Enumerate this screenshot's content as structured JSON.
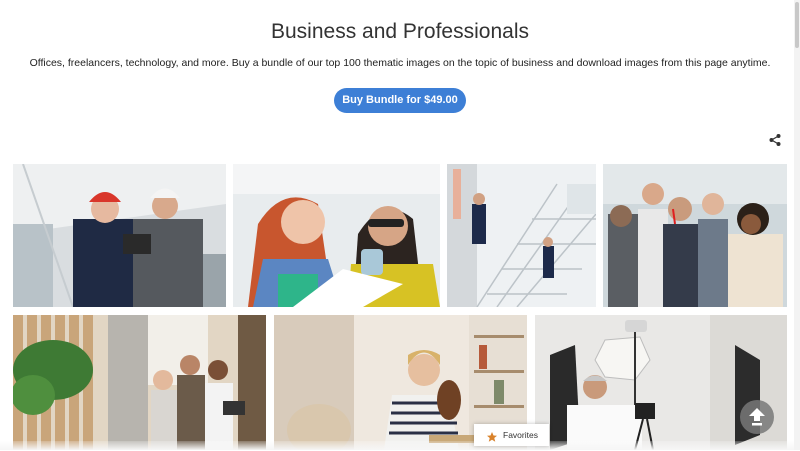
{
  "header": {
    "title": "Business and Professionals",
    "subtitle": "Offices, freelancers, technology, and more. Buy a bundle of our top 100 thematic images on the topic of business and download images from this page anytime.",
    "buy_button_label": "Buy Bundle for $49.00"
  },
  "toolbar": {
    "share_icon": "share-icon"
  },
  "gallery": {
    "photos": [
      {
        "name": "photo-engineers-hardhats",
        "subject": "engineers"
      },
      {
        "name": "photo-women-reviewing-document",
        "subject": "women"
      },
      {
        "name": "photo-office-staircase",
        "subject": "staircase"
      },
      {
        "name": "photo-team-glass-board",
        "subject": "team"
      },
      {
        "name": "photo-team-with-laptop",
        "subject": "laptop"
      },
      {
        "name": "photo-woman-on-phone",
        "subject": "phone"
      },
      {
        "name": "photo-photographer-studio",
        "subject": "studio"
      }
    ]
  },
  "favorites": {
    "label": "Favorites",
    "icon": "star-icon",
    "color": "#d9822b"
  },
  "scroll_to_top": {
    "icon": "arrow-up-icon"
  },
  "colors": {
    "accent": "#3d7fd6"
  }
}
